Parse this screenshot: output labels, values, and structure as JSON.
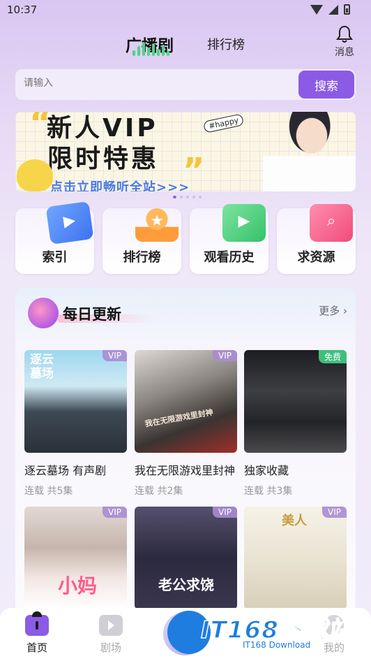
{
  "status_bar": {
    "time": "10:37"
  },
  "header": {
    "tab_active": "广播剧",
    "tab_other": "排行榜",
    "bell_label": "消息"
  },
  "search": {
    "placeholder": "请输入",
    "button": "搜索"
  },
  "banner": {
    "line1": "新人VIP",
    "line2": "限时特惠",
    "line3": "点击立即畅听全站>>>",
    "tag": "#happy",
    "page_count": 5,
    "active_index": 0
  },
  "shortcuts": [
    {
      "label": "索引",
      "icon": "film-icon"
    },
    {
      "label": "排行榜",
      "icon": "trophy-icon"
    },
    {
      "label": "观看历史",
      "icon": "history-icon"
    },
    {
      "label": "求资源",
      "icon": "search-folder-icon"
    }
  ],
  "daily": {
    "title": "每日更新",
    "more": "更多",
    "books": [
      {
        "title": "逐云墓场 有声剧",
        "meta": "连载 共5集",
        "tag": "VIP",
        "cover_text": "逐云墓场"
      },
      {
        "title": "我在无限游戏里封神",
        "meta": "连载 共2集",
        "tag": "VIP",
        "cover_text": "我在无限游戏里封神"
      },
      {
        "title": "独家收藏",
        "meta": "连载 共3集",
        "tag": "免费",
        "cover_text": ""
      },
      {
        "title": "",
        "meta": "",
        "tag": "VIP",
        "cover_text": "小妈"
      },
      {
        "title": "",
        "meta": "",
        "tag": "VIP",
        "cover_text": "老公求饶"
      },
      {
        "title": "",
        "meta": "",
        "tag": "VIP",
        "cover_text": "美人"
      }
    ]
  },
  "bottom_nav": {
    "home": "首页",
    "theater": "剧场",
    "mine": "我的"
  },
  "watermark": {
    "title": "IT168下载站",
    "sub": "IT168 Download"
  },
  "colors": {
    "accent": "#8b5be5",
    "free": "#3fbf7f"
  }
}
